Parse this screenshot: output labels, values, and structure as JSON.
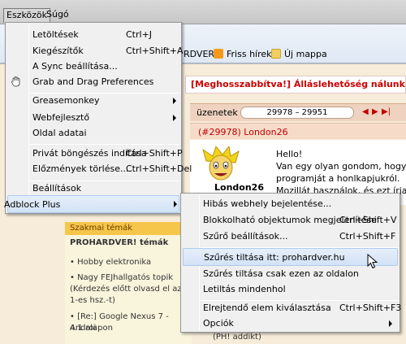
{
  "menubar": {
    "tools": "Eszközök",
    "help": "Súgó"
  },
  "bookmarks": {
    "partial": "RDVER",
    "rss": "Friss hírek",
    "folder": "Új mappa"
  },
  "page": {
    "banner": "[Meghosszabbítva!] Álláslehetőség nálunk: az IT C",
    "posts_label": "üzenetek",
    "pager": "29978 – 29951",
    "post_number": "(#29978)",
    "post_user": "London26",
    "avatar_name": "London26",
    "post_lines": [
      "Hello!",
      "Van egy olyan gondom, hogy",
      "programját a honlkapjukról.",
      "Mozillát használok, és ezt írja ki"
    ],
    "sidebar_section": "Szakmai témák",
    "sidebar_heading": "PROHARDVER! témák",
    "sidebar_items": [
      "• Hobby elektronika",
      "• Nagy FEJhallgatós topik",
      "(Kérdezés előtt olvasd el az",
      "1-es hsz.-t)",
      "• [Re:] Google Nexus 7 - Androi",
      "4.1 alapon"
    ],
    "bottom_right": "(PH! addikt)"
  },
  "tools_menu": {
    "items": [
      {
        "label": "Letöltések",
        "accel": "Ctrl+J"
      },
      {
        "label": "Kiegészítők",
        "accel": "Ctrl+Shift+A"
      },
      {
        "label": "A Sync beállítása...",
        "accel": ""
      },
      {
        "label": "Grab and Drag Preferences",
        "accel": ""
      },
      {
        "label": "Greasemonkey",
        "accel": ""
      },
      {
        "label": "Webfejlesztő",
        "accel": ""
      },
      {
        "label": "Oldal adatai",
        "accel": ""
      },
      {
        "label": "Privát böngészés indítása",
        "accel": "Ctrl+Shift+P"
      },
      {
        "label": "Előzmények törlése...",
        "accel": "Ctrl+Shift+Del"
      },
      {
        "label": "Beállítások",
        "accel": ""
      },
      {
        "label": "Adblock Plus",
        "accel": ""
      }
    ]
  },
  "adblock_menu": {
    "items": [
      {
        "label": "Hibás webhely bejelentése...",
        "accel": ""
      },
      {
        "label": "Blokkolható objektumok megjelenítése",
        "accel": "Ctrl+Shift+V"
      },
      {
        "label": "Szűrő beállítások...",
        "accel": "Ctrl+Shift+F"
      },
      {
        "label": "Szűrés tiltása itt: prohardver.hu",
        "accel": ""
      },
      {
        "label": "Szűrés tiltása csak ezen az oldalon",
        "accel": ""
      },
      {
        "label": "Letiltás mindenhol",
        "accel": ""
      },
      {
        "label": "Elrejtendő elem kiválasztása",
        "accel": "Ctrl+Shift+F3"
      },
      {
        "label": "Opciók",
        "accel": ""
      }
    ]
  }
}
